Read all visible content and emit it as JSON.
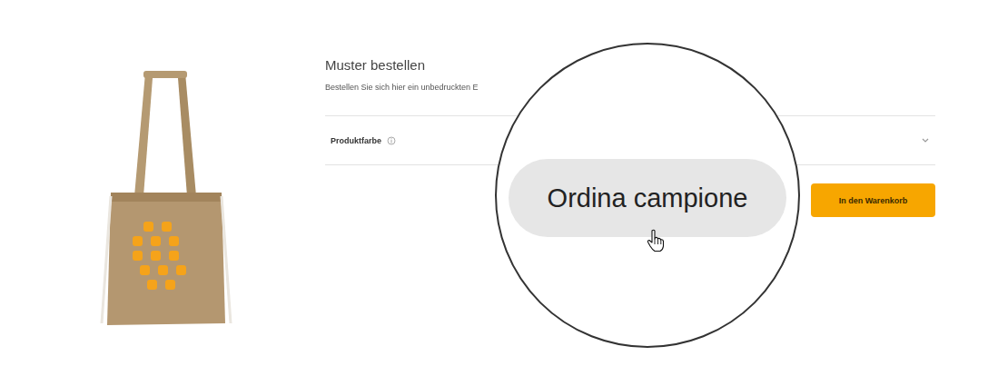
{
  "sample": {
    "title": "Muster bestellen",
    "description": "Bestellen Sie sich hier ein unbedruckten E"
  },
  "options": [
    {
      "label": "Produktfarbe"
    }
  ],
  "cart_button": "In den Warenkorb",
  "magnifier": {
    "button": "Ordina campione"
  }
}
